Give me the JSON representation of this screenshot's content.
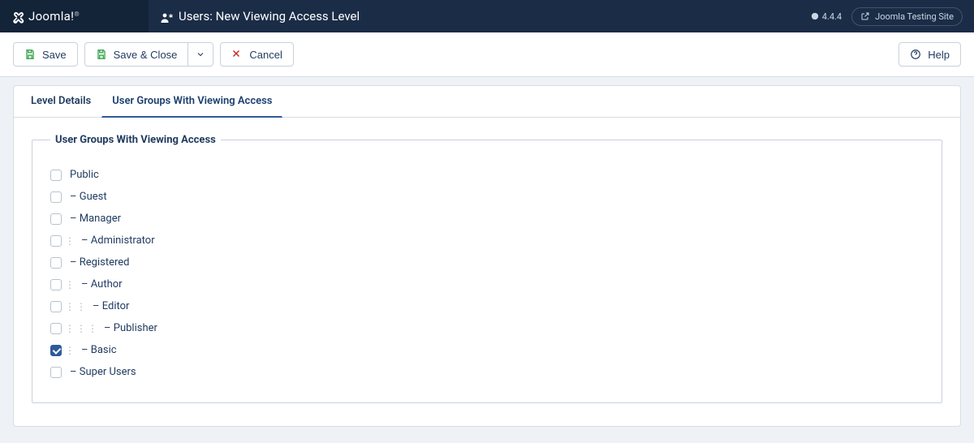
{
  "header": {
    "brand": "Joomla!",
    "title": "Users: New Viewing Access Level",
    "version": "4.4.4",
    "site_link": "Joomla Testing Site"
  },
  "toolbar": {
    "save": "Save",
    "save_close": "Save & Close",
    "cancel": "Cancel",
    "help": "Help"
  },
  "tabs": [
    {
      "id": "level-details",
      "label": "Level Details",
      "active": false
    },
    {
      "id": "user-groups",
      "label": "User Groups With Viewing Access",
      "active": true
    }
  ],
  "fieldset_legend": "User Groups With Viewing Access",
  "groups": [
    {
      "label": "Public",
      "depth": 0,
      "checked": false
    },
    {
      "label": "Guest",
      "depth": 1,
      "checked": false
    },
    {
      "label": "Manager",
      "depth": 1,
      "checked": false
    },
    {
      "label": "Administrator",
      "depth": 2,
      "checked": false
    },
    {
      "label": "Registered",
      "depth": 1,
      "checked": false
    },
    {
      "label": "Author",
      "depth": 2,
      "checked": false
    },
    {
      "label": "Editor",
      "depth": 3,
      "checked": false
    },
    {
      "label": "Publisher",
      "depth": 4,
      "checked": false
    },
    {
      "label": "Basic",
      "depth": 2,
      "checked": true
    },
    {
      "label": "Super Users",
      "depth": 1,
      "checked": false
    }
  ]
}
